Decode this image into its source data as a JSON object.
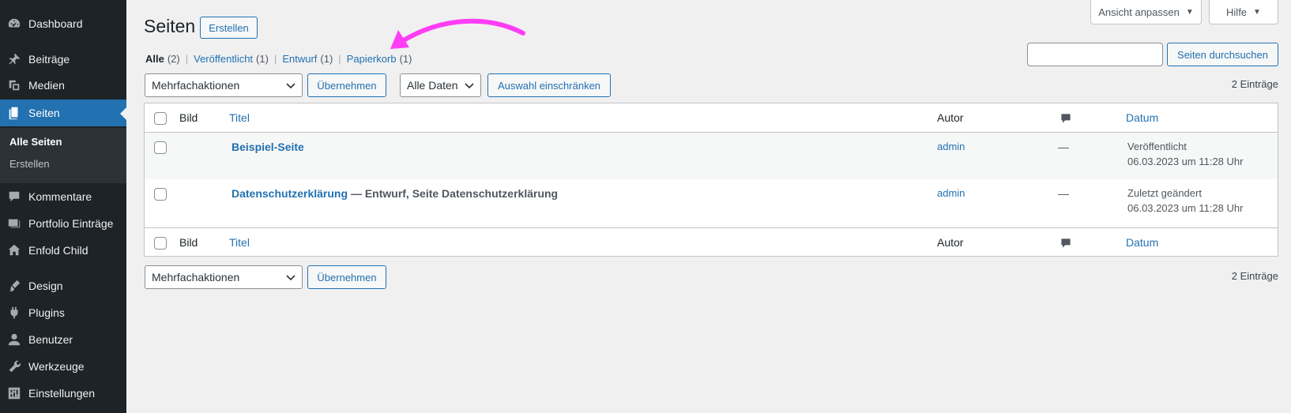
{
  "sidebar": {
    "items": [
      {
        "label": "Dashboard",
        "icon": "dashboard-icon"
      },
      {
        "label": "Beiträge",
        "icon": "pin-icon"
      },
      {
        "label": "Medien",
        "icon": "media-icon"
      },
      {
        "label": "Seiten",
        "icon": "page-icon"
      },
      {
        "label": "Kommentare",
        "icon": "comment-icon"
      },
      {
        "label": "Portfolio Einträge",
        "icon": "portfolio-icon"
      },
      {
        "label": "Enfold Child",
        "icon": "home-icon"
      },
      {
        "label": "Design",
        "icon": "brush-icon"
      },
      {
        "label": "Plugins",
        "icon": "plugin-icon"
      },
      {
        "label": "Benutzer",
        "icon": "user-icon"
      },
      {
        "label": "Werkzeuge",
        "icon": "wrench-icon"
      },
      {
        "label": "Einstellungen",
        "icon": "settings-icon"
      }
    ],
    "submenu": {
      "all_pages": "Alle Seiten",
      "create": "Erstellen"
    }
  },
  "topbar": {
    "screen_options": "Ansicht anpassen",
    "help": "Hilfe"
  },
  "header": {
    "title": "Seiten",
    "add_new": "Erstellen"
  },
  "views": [
    {
      "label": "Alle",
      "count": "(2)"
    },
    {
      "label": "Veröffentlicht",
      "count": "(1)"
    },
    {
      "label": "Entwurf",
      "count": "(1)"
    },
    {
      "label": "Papierkorb",
      "count": "(1)"
    }
  ],
  "search": {
    "button": "Seiten durchsuchen",
    "value": ""
  },
  "bulk": {
    "actions": "Mehrfachaktionen",
    "apply": "Übernehmen",
    "dates": "Alle Daten",
    "filter": "Auswahl einschränken"
  },
  "count_label": "2 Einträge",
  "table": {
    "columns": {
      "image": "Bild",
      "title": "Titel",
      "author": "Autor",
      "date": "Datum"
    },
    "rows": [
      {
        "title": "Beispiel-Seite",
        "state": "",
        "author": "admin",
        "comments": "—",
        "date_status": "Veröffentlicht",
        "date": "06.03.2023 um 11:28 Uhr"
      },
      {
        "title": "Datenschutzerklärung",
        "state": "— Entwurf, Seite Datenschutzerklärung",
        "author": "admin",
        "comments": "—",
        "date_status": "Zuletzt geändert",
        "date": "06.03.2023 um 11:28 Uhr"
      }
    ]
  },
  "colors": {
    "accent": "#2271b1",
    "sidebar_bg": "#1d2327",
    "arrow": "#ff3df5"
  }
}
